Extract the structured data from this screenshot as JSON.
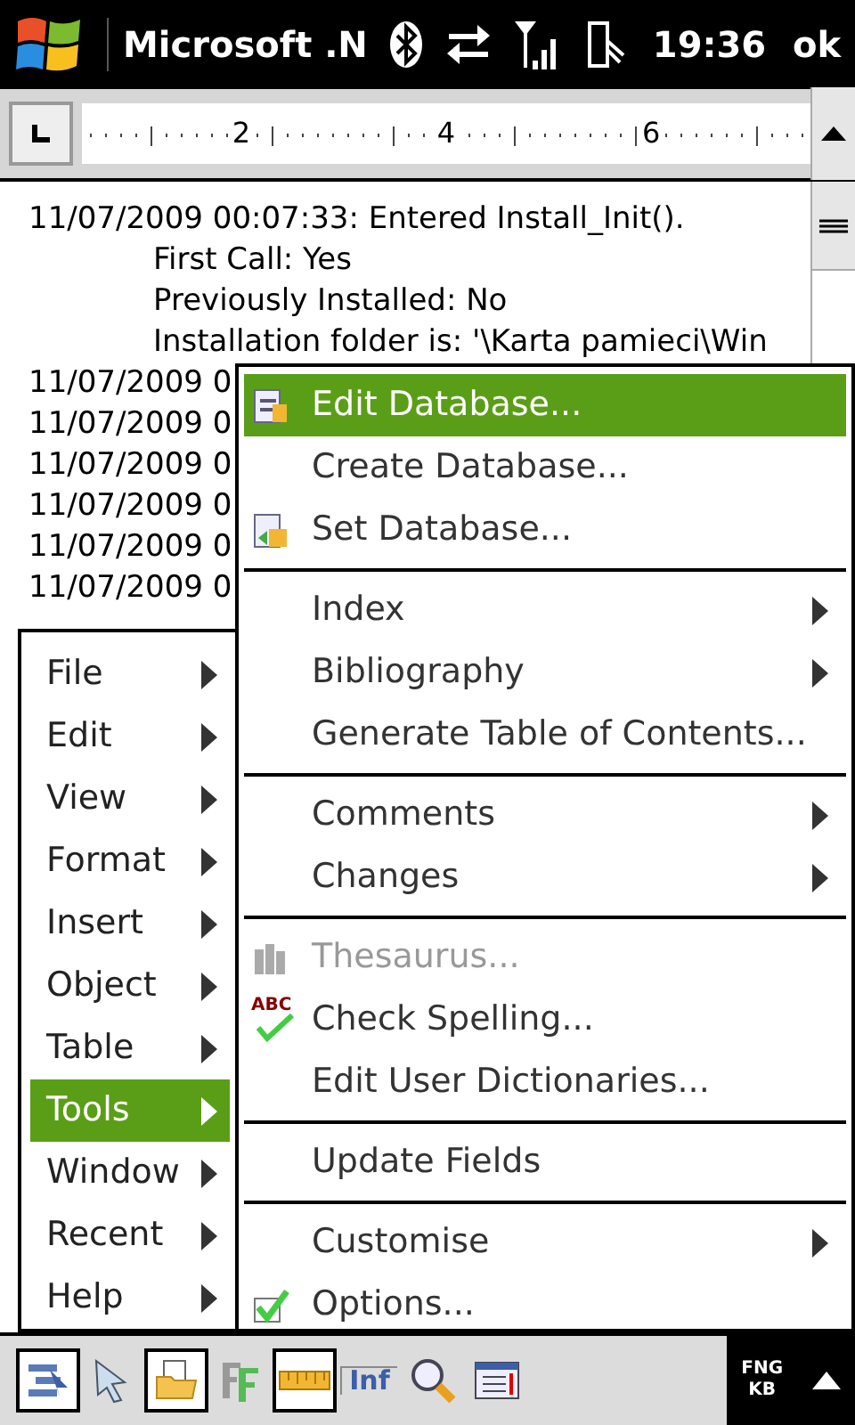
{
  "status_bar": {
    "title": "Microsoft .N",
    "time": "19:36",
    "ok": "ok"
  },
  "ruler": {
    "labels": [
      "2",
      "4",
      "6"
    ]
  },
  "document": {
    "lines": [
      {
        "kind": "entry",
        "text": "11/07/2009 00:07:33: Entered Install_Init()."
      },
      {
        "kind": "detail",
        "text": "First Call: Yes"
      },
      {
        "kind": "detail",
        "text": "Previously Installed: No"
      },
      {
        "kind": "detail",
        "text": "Installation folder is: '\\Karta pamieci\\Win"
      },
      {
        "kind": "entry",
        "text": "11/07/2009 0"
      },
      {
        "kind": "entry",
        "text": "11/07/2009 0"
      },
      {
        "kind": "entry",
        "text": "11/07/2009 0"
      },
      {
        "kind": "entry",
        "text": "11/07/2009 0"
      },
      {
        "kind": "entry",
        "text": "11/07/2009 0"
      },
      {
        "kind": "entry",
        "text": "11/07/2009 0"
      }
    ]
  },
  "menu": {
    "items": [
      {
        "label": "File",
        "selected": false
      },
      {
        "label": "Edit",
        "selected": false
      },
      {
        "label": "View",
        "selected": false
      },
      {
        "label": "Format",
        "selected": false
      },
      {
        "label": "Insert",
        "selected": false
      },
      {
        "label": "Object",
        "selected": false
      },
      {
        "label": "Table",
        "selected": false
      },
      {
        "label": "Tools",
        "selected": true
      },
      {
        "label": "Window",
        "selected": false
      },
      {
        "label": "Recent",
        "selected": false
      },
      {
        "label": "Help",
        "selected": false
      }
    ]
  },
  "submenu": {
    "groups": [
      [
        {
          "label": "Edit Database...",
          "kind": "database",
          "selected": true,
          "disabled": false,
          "submenu": false
        },
        {
          "label": "Create Database...",
          "kind": "plain",
          "selected": false,
          "disabled": false,
          "submenu": false
        },
        {
          "label": "Set Database...",
          "kind": "linked",
          "selected": false,
          "disabled": false,
          "submenu": false
        }
      ],
      [
        {
          "label": "Index",
          "kind": "plain",
          "selected": false,
          "disabled": false,
          "submenu": true
        },
        {
          "label": "Bibliography",
          "kind": "plain",
          "selected": false,
          "disabled": false,
          "submenu": true
        },
        {
          "label": "Generate Table of Contents...",
          "kind": "plain",
          "selected": false,
          "disabled": false,
          "submenu": false
        }
      ],
      [
        {
          "label": "Comments",
          "kind": "plain",
          "selected": false,
          "disabled": false,
          "submenu": true
        },
        {
          "label": "Changes",
          "kind": "plain",
          "selected": false,
          "disabled": false,
          "submenu": true
        }
      ],
      [
        {
          "label": "Thesaurus...",
          "kind": "thesaurus",
          "selected": false,
          "disabled": true,
          "submenu": false
        },
        {
          "label": "Check Spelling...",
          "kind": "spelling",
          "icon_text": "ABC",
          "selected": false,
          "disabled": false,
          "submenu": false
        },
        {
          "label": "Edit User Dictionaries...",
          "kind": "plain",
          "selected": false,
          "disabled": false,
          "submenu": false
        }
      ],
      [
        {
          "label": "Update Fields",
          "kind": "plain",
          "selected": false,
          "disabled": false,
          "submenu": false
        }
      ],
      [
        {
          "label": "Customise",
          "kind": "plain",
          "selected": false,
          "disabled": false,
          "submenu": true
        },
        {
          "label": "Options...",
          "kind": "options",
          "selected": false,
          "disabled": false,
          "submenu": false
        }
      ]
    ]
  },
  "toolbar": {
    "buttons": [
      {
        "kind": "outline",
        "pressed": true
      },
      {
        "kind": "pointer",
        "pressed": false
      },
      {
        "kind": "folder",
        "pressed": true
      },
      {
        "kind": "font",
        "pressed": false
      },
      {
        "kind": "ruler",
        "pressed": true
      },
      {
        "kind": "info",
        "pressed": false,
        "label": "Inf"
      },
      {
        "kind": "zoom",
        "pressed": false
      },
      {
        "kind": "form",
        "pressed": false
      }
    ],
    "keyboard": {
      "top": "FNG",
      "bottom": "KB"
    }
  }
}
